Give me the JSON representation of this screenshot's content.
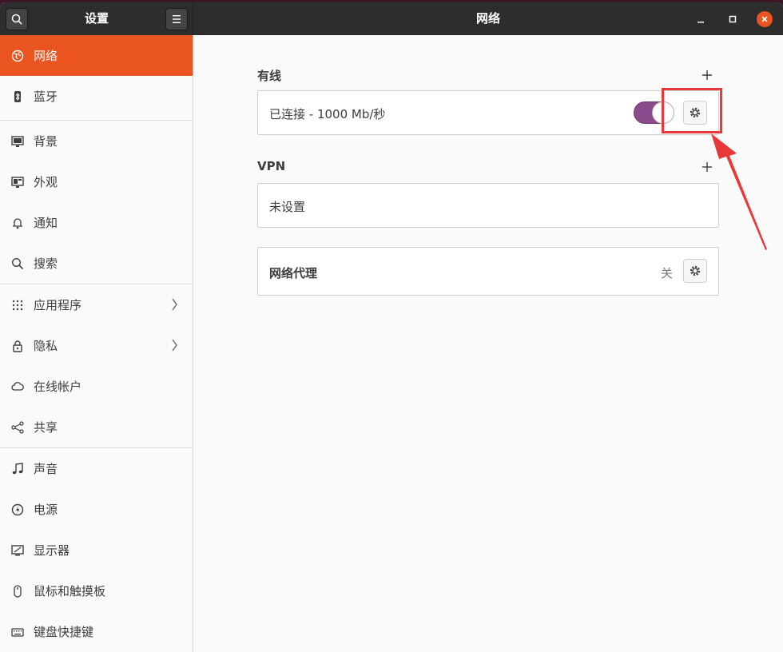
{
  "header": {
    "sidebar_title": "设置",
    "main_title": "网络"
  },
  "sidebar": {
    "items": [
      {
        "label": "网络",
        "icon": "network-icon",
        "active": true
      },
      {
        "label": "蓝牙",
        "icon": "bluetooth-icon"
      },
      {
        "label": "背景",
        "icon": "background-icon"
      },
      {
        "label": "外观",
        "icon": "appearance-icon"
      },
      {
        "label": "通知",
        "icon": "bell-icon"
      },
      {
        "label": "搜索",
        "icon": "search-icon"
      },
      {
        "label": "应用程序",
        "icon": "apps-grid-icon",
        "has_chevron": true
      },
      {
        "label": "隐私",
        "icon": "lock-icon",
        "has_chevron": true
      },
      {
        "label": "在线帐户",
        "icon": "cloud-icon"
      },
      {
        "label": "共享",
        "icon": "share-icon"
      },
      {
        "label": "声音",
        "icon": "music-note-icon"
      },
      {
        "label": "电源",
        "icon": "power-icon"
      },
      {
        "label": "显示器",
        "icon": "display-icon"
      },
      {
        "label": "鼠标和触摸板",
        "icon": "mouse-icon"
      },
      {
        "label": "键盘快捷键",
        "icon": "keyboard-icon"
      }
    ]
  },
  "wired": {
    "title": "有线",
    "status": "已连接 - 1000 Mb/秒",
    "enabled": true
  },
  "vpn": {
    "title": "VPN",
    "status": "未设置"
  },
  "proxy": {
    "title": "网络代理",
    "status": "关"
  },
  "colors": {
    "accent": "#e95420",
    "switch_on": "#8a4a8c",
    "annotation": "#e8383a",
    "headerbar": "#2d2d2d"
  }
}
